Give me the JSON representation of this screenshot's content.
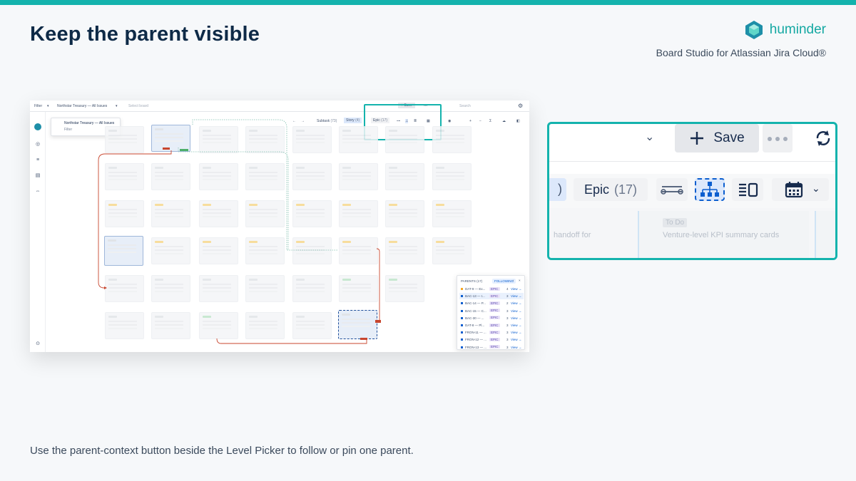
{
  "slide": {
    "title": "Keep the parent visible",
    "brand_name": "huminder",
    "tagline": "Board Studio for Atlassian Jira Cloud®",
    "caption": "Use the parent-context button beside the Level Picker to follow or pin one parent.",
    "accent_color": "#14b3ad"
  },
  "screenshot": {
    "topbar": {
      "filter_label": "Filter",
      "board_name": "Northstar Treasury — All Issues",
      "select_board_placeholder": "Select board",
      "save_label": "Save",
      "search_placeholder": "Search"
    },
    "filter_popover": {
      "title": "Northstar Treasury — All Issues",
      "subtitle": "Filter"
    },
    "toolbar": {
      "subtask_label": "Subtask",
      "subtask_count": "(73)",
      "story_label": "Story",
      "story_count": "(4)",
      "epic_label": "Epic",
      "epic_count": "(17)"
    },
    "parents_panel": {
      "header": "PARENTS (17)",
      "following_label": "FOLLOWING",
      "rows": [
        {
          "key": "DAT-9 — Ex...",
          "badge": "EPIC",
          "count": "4",
          "view": "View",
          "color": "#f5a623"
        },
        {
          "key": "BAC-13 — I...",
          "badge": "EPIC",
          "count": "3",
          "view": "View",
          "color": "#0b5ecf",
          "active": true
        },
        {
          "key": "BAC-14 — P...",
          "badge": "EPIC",
          "count": "2",
          "view": "View",
          "color": "#0b5ecf"
        },
        {
          "key": "BAC-15 — C...",
          "badge": "EPIC",
          "count": "3",
          "view": "View",
          "color": "#0b5ecf"
        },
        {
          "key": "BAC-30 — ...",
          "badge": "EPIC",
          "count": "3",
          "view": "View",
          "color": "#0b5ecf"
        },
        {
          "key": "DAT-8 — Pl...",
          "badge": "EPIC",
          "count": "3",
          "view": "View",
          "color": "#0b5ecf"
        },
        {
          "key": "FRON-11 — ...",
          "badge": "EPIC",
          "count": "3",
          "view": "View",
          "color": "#0b5ecf"
        },
        {
          "key": "FRON-12 — ...",
          "badge": "EPIC",
          "count": "3",
          "view": "View",
          "color": "#0b5ecf"
        },
        {
          "key": "FRON-13 — ...",
          "badge": "EPIC",
          "count": "3",
          "view": "View",
          "color": "#0b5ecf"
        }
      ]
    }
  },
  "zoom": {
    "save_label": "Save",
    "story_partial": ")",
    "epic_label": "Epic",
    "epic_count": "(17)",
    "ghost_texts": [
      "To Do",
      "handoff for",
      "Venture-level KPI summary cards"
    ]
  }
}
